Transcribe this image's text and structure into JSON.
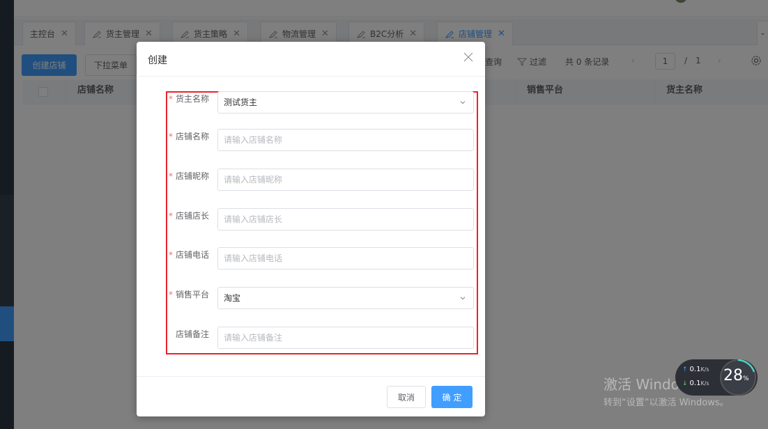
{
  "tabs": [
    {
      "label": "主控台",
      "active": false,
      "has_icon": false
    },
    {
      "label": "货主管理",
      "active": false,
      "has_icon": true
    },
    {
      "label": "货主策略",
      "active": false,
      "has_icon": true
    },
    {
      "label": "物流管理",
      "active": false,
      "has_icon": true
    },
    {
      "label": "B2C分析",
      "active": false,
      "has_icon": true
    },
    {
      "label": "店铺管理",
      "active": true,
      "has_icon": true
    }
  ],
  "toolbar": {
    "create_label": "创建店铺",
    "dropdown_label": "下拉菜单",
    "query_label": "查询",
    "filter_label": "过滤",
    "total_label": "共 0 条记录",
    "current_page": "1",
    "page_sep": "/",
    "page_total": "1"
  },
  "table": {
    "columns": [
      "店铺名称",
      "销售平台",
      "货主名称"
    ]
  },
  "dialog": {
    "title": "创建",
    "fields": [
      {
        "label": "货主名称",
        "required": true,
        "type": "select",
        "value": "测试货主",
        "placeholder": ""
      },
      {
        "label": "店铺名称",
        "required": true,
        "type": "input",
        "value": "",
        "placeholder": "请输入店铺名称"
      },
      {
        "label": "店铺昵称",
        "required": true,
        "type": "input",
        "value": "",
        "placeholder": "请输入店铺昵称"
      },
      {
        "label": "店铺店长",
        "required": true,
        "type": "input",
        "value": "",
        "placeholder": "请输入店铺店长"
      },
      {
        "label": "店铺电话",
        "required": true,
        "type": "input",
        "value": "",
        "placeholder": "请输入店铺电话"
      },
      {
        "label": "销售平台",
        "required": true,
        "type": "select",
        "value": "淘宝",
        "placeholder": ""
      },
      {
        "label": "店铺备注",
        "required": false,
        "type": "input",
        "value": "",
        "placeholder": "请输入店铺备注"
      }
    ],
    "cancel_label": "取消",
    "ok_label": "确定"
  },
  "watermark": {
    "line1": "激活 Windows",
    "line2": "转到“设置”以激活 Windows。"
  },
  "net_widget": {
    "upload": "0.1",
    "download": "0.1",
    "unit": "K/s",
    "percent": "28",
    "percent_sign": "%"
  },
  "colors": {
    "primary": "#409eff",
    "highlight_border": "#e8242a",
    "required_star": "#f56c6c"
  }
}
